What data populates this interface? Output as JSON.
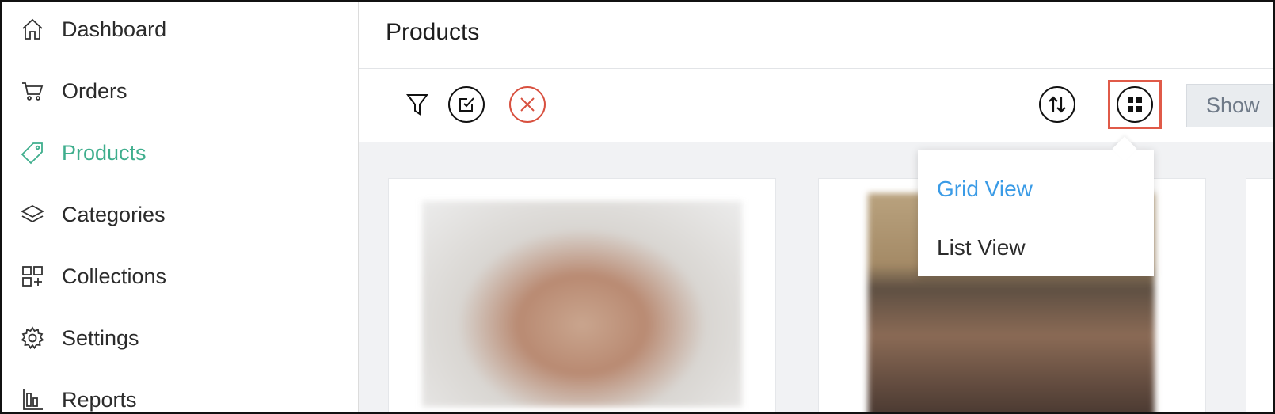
{
  "sidebar": {
    "items": [
      {
        "label": "Dashboard",
        "icon": "home-icon"
      },
      {
        "label": "Orders",
        "icon": "cart-icon"
      },
      {
        "label": "Products",
        "icon": "tag-icon",
        "active": true
      },
      {
        "label": "Categories",
        "icon": "layers-icon"
      },
      {
        "label": "Collections",
        "icon": "collections-icon"
      },
      {
        "label": "Settings",
        "icon": "gear-icon"
      },
      {
        "label": "Reports",
        "icon": "reports-icon"
      }
    ],
    "active_color": "#3fae8d"
  },
  "header": {
    "title": "Products"
  },
  "toolbar": {
    "filter_icon": "filter-icon",
    "select_icon": "select-icon",
    "clear_icon": "close-icon",
    "sort_icon": "sort-icon",
    "view_icon": "grid-icon",
    "show_label": "Show",
    "highlight_color": "#e05a48"
  },
  "view_menu": {
    "items": [
      {
        "label": "Grid View",
        "selected": true
      },
      {
        "label": "List View",
        "selected": false
      }
    ],
    "selected_color": "#3a9be6"
  }
}
